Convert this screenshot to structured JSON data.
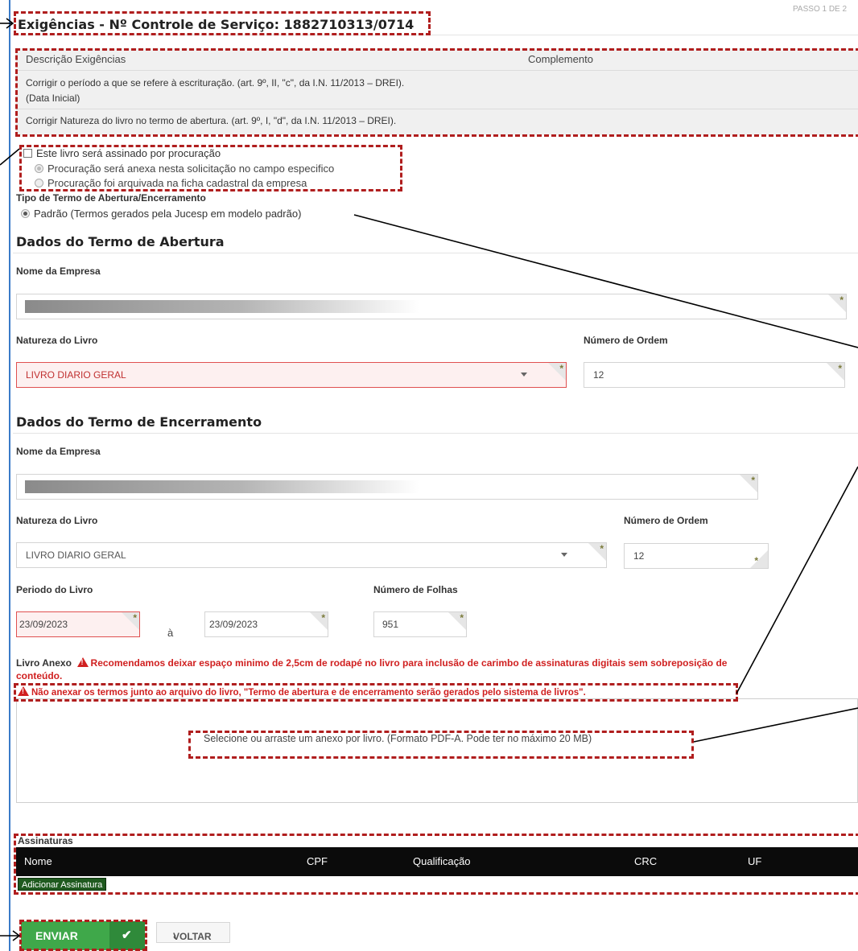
{
  "header": {
    "step": "PASSO 1 DE 2",
    "title": "Exigências - Nº Controle de Serviço: 1882710313/0714"
  },
  "requirements": {
    "col_description": "Descrição Exigências",
    "col_complement": "Complemento",
    "items": [
      {
        "line1": "Corrigir o período a que se refere à escrituração. (art. 9º, II, \"c\", da I.N. 11/2013 – DREI).",
        "line2": "(Data Inicial)"
      },
      {
        "line1": "Corrigir Natureza do livro no termo de abertura. (art. 9º, I, \"d\", da I.N. 11/2013 – DREI)."
      }
    ]
  },
  "proxy": {
    "checkbox_label": "Este livro será assinado por procuração",
    "option_attached": "Procuração será anexa nesta solicitação no campo especifico",
    "option_archived": "Procuração foi arquivada na ficha cadastral da empresa"
  },
  "term_type": {
    "label": "Tipo de Termo de Abertura/Encerramento",
    "option_standard": "Padrão (Termos gerados pela Jucesp em modelo padrão)"
  },
  "opening": {
    "title": "Dados do Termo de Abertura",
    "company_label": "Nome da Empresa",
    "nature_label": "Natureza do Livro",
    "nature_value": "LIVRO DIARIO GERAL",
    "order_label": "Número de Ordem",
    "order_value": "12"
  },
  "closing": {
    "title": "Dados do Termo de Encerramento",
    "company_label": "Nome da Empresa",
    "nature_label": "Natureza do Livro",
    "nature_value": "LIVRO DIARIO GERAL",
    "order_label": "Número de Ordem",
    "order_value": "12",
    "period_label": "Periodo do Livro",
    "period_start": "23/09/2023",
    "period_sep": "à",
    "period_end": "23/09/2023",
    "pages_label": "Número de Folhas",
    "pages_value": "951"
  },
  "attachment": {
    "label": "Livro Anexo",
    "warning1a": "Recomendamos deixar espaço minimo de 2,5cm de rodapé no livro para inclusão de carimbo de assinaturas digitais sem sobreposição de",
    "warning1b": "conteúdo.",
    "warning2": "Não anexar os termos junto ao arquivo do livro, \"Termo de abertura e de encerramento serão gerados pelo sistema de livros\".",
    "dropzone_text": "Selecione ou arraste um anexo por livro. (Formato PDF-A. Pode ter no máximo 20 MB)"
  },
  "signatures": {
    "title": "Assinaturas",
    "columns": [
      "Nome",
      "CPF",
      "Qualificação",
      "CRC",
      "UF"
    ],
    "add_button": "Adicionar Assinatura"
  },
  "actions": {
    "send": "ENVIAR",
    "back": "VOLTAR"
  },
  "colors": {
    "annotation": "#b01e1e",
    "send_button": "#3fa84a",
    "error_field": "#e05050",
    "warning_text": "#d02020"
  }
}
